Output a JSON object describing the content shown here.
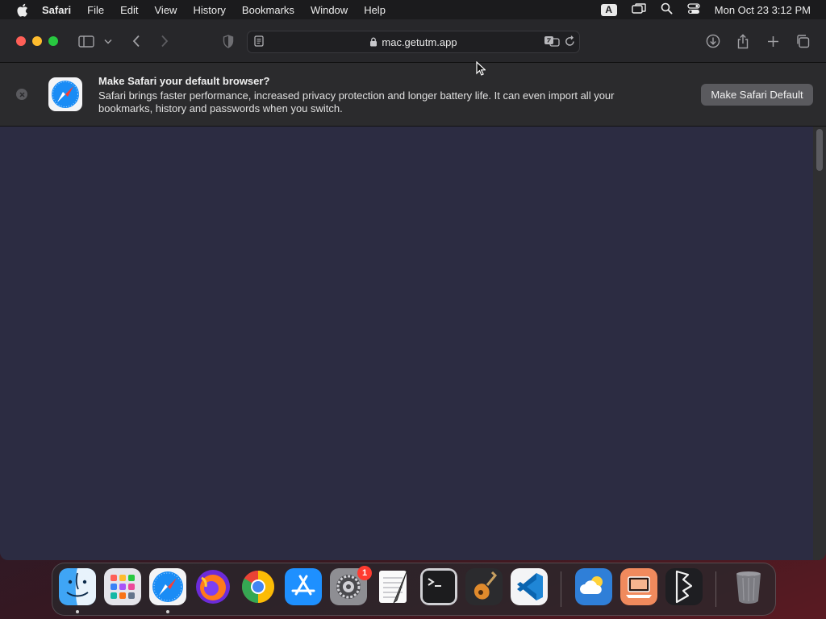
{
  "menubar": {
    "app_name": "Safari",
    "items": [
      "File",
      "Edit",
      "View",
      "History",
      "Bookmarks",
      "Window",
      "Help"
    ],
    "input_source": "A",
    "clock": "Mon Oct 23  3:12 PM"
  },
  "toolbar": {
    "url": "mac.getutm.app"
  },
  "banner": {
    "title": "Make Safari your default browser?",
    "body": "Safari brings faster performance, increased privacy protection and longer battery life. It can even import all your bookmarks, history and passwords when you switch.",
    "button_label": "Make Safari Default"
  },
  "dock": {
    "apps": [
      "finder-icon",
      "launchpad-icon",
      "safari-icon",
      "firefox-icon",
      "chrome-icon",
      "app-store-icon",
      "system-settings-icon",
      "textedit-icon",
      "terminal-icon",
      "garageband-icon",
      "vscode-icon",
      "weather-icon",
      "utm-icon",
      "bbedit-icon",
      "trash-icon"
    ],
    "settings_badge": "1"
  },
  "colors": {
    "content_bg": "#2c2c42",
    "close": "#ff5f57",
    "minimize": "#febc2e",
    "zoom": "#28c840",
    "badge": "#ff3b30"
  }
}
